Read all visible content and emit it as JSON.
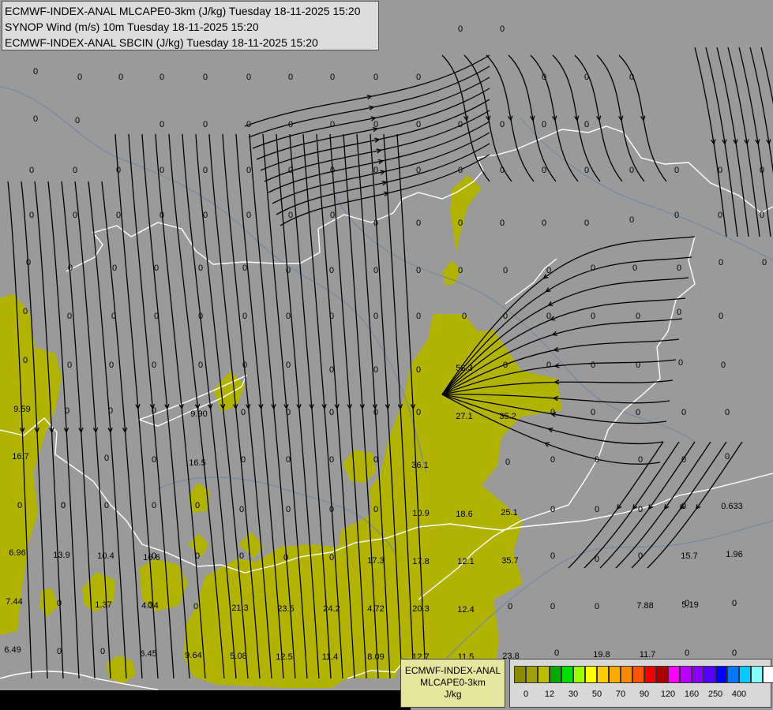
{
  "header": {
    "line1": "ECMWF-INDEX-ANAL MLCAPE0-3km (J/kg) Tuesday 18-11-2025 15:20",
    "line2": "SYNOP Wind (m/s) 10m Tuesday 18-11-2025 15:20",
    "line3": "ECMWF-INDEX-ANAL SBCIN (J/kg) Tuesday 18-11-2025 15:20"
  },
  "legend": {
    "title_line1": "ECMWF-INDEX-ANAL",
    "title_line2": "MLCAPE0-3km",
    "unit": "J/kg",
    "colors": [
      "#8b8b00",
      "#a0a000",
      "#bcbc00",
      "#00aa00",
      "#00dd00",
      "#99ff00",
      "#ffff00",
      "#ffcc00",
      "#ffaa00",
      "#ff8800",
      "#ff5500",
      "#ee0000",
      "#aa0000",
      "#ff00ff",
      "#bb00ff",
      "#8800ff",
      "#5500ff",
      "#0000ff",
      "#0077ff",
      "#00ccff",
      "#88ffff",
      "#ffffff"
    ],
    "ticks": [
      "0",
      "12",
      "30",
      "50",
      "70",
      "90",
      "120",
      "160",
      "250",
      "400"
    ]
  },
  "map_values": {
    "zeros": [
      [
        45,
        90
      ],
      [
        101,
        97
      ],
      [
        153,
        97
      ],
      [
        205,
        97
      ],
      [
        260,
        97
      ],
      [
        315,
        97
      ],
      [
        368,
        97
      ],
      [
        421,
        97
      ],
      [
        476,
        97
      ],
      [
        530,
        97
      ],
      [
        583,
        36
      ],
      [
        636,
        36
      ],
      [
        689,
        97
      ],
      [
        743,
        97
      ],
      [
        800,
        97
      ],
      [
        45,
        150
      ],
      [
        98,
        152
      ],
      [
        205,
        157
      ],
      [
        260,
        157
      ],
      [
        315,
        157
      ],
      [
        368,
        157
      ],
      [
        421,
        157
      ],
      [
        476,
        157
      ],
      [
        530,
        157
      ],
      [
        583,
        157
      ],
      [
        636,
        157
      ],
      [
        689,
        157
      ],
      [
        743,
        157
      ],
      [
        40,
        215
      ],
      [
        95,
        215
      ],
      [
        150,
        215
      ],
      [
        205,
        215
      ],
      [
        260,
        215
      ],
      [
        315,
        215
      ],
      [
        368,
        215
      ],
      [
        421,
        215
      ],
      [
        476,
        215
      ],
      [
        530,
        215
      ],
      [
        583,
        215
      ],
      [
        636,
        215
      ],
      [
        689,
        215
      ],
      [
        743,
        215
      ],
      [
        800,
        215
      ],
      [
        857,
        215
      ],
      [
        912,
        215
      ],
      [
        965,
        215
      ],
      [
        40,
        272
      ],
      [
        95,
        272
      ],
      [
        150,
        272
      ],
      [
        205,
        272
      ],
      [
        260,
        272
      ],
      [
        315,
        272
      ],
      [
        368,
        272
      ],
      [
        421,
        272
      ],
      [
        476,
        282
      ],
      [
        530,
        282
      ],
      [
        583,
        282
      ],
      [
        636,
        282
      ],
      [
        689,
        282
      ],
      [
        743,
        282
      ],
      [
        800,
        278
      ],
      [
        857,
        272
      ],
      [
        912,
        272
      ],
      [
        965,
        272
      ],
      [
        36,
        332
      ],
      [
        89,
        339
      ],
      [
        145,
        339
      ],
      [
        198,
        339
      ],
      [
        254,
        339
      ],
      [
        310,
        339
      ],
      [
        365,
        342
      ],
      [
        420,
        342
      ],
      [
        476,
        342
      ],
      [
        530,
        342
      ],
      [
        583,
        342
      ],
      [
        640,
        342
      ],
      [
        695,
        342
      ],
      [
        751,
        339
      ],
      [
        804,
        339
      ],
      [
        860,
        339
      ],
      [
        913,
        332
      ],
      [
        968,
        332
      ],
      [
        32,
        394
      ],
      [
        88,
        400
      ],
      [
        144,
        400
      ],
      [
        198,
        400
      ],
      [
        254,
        400
      ],
      [
        310,
        400
      ],
      [
        365,
        400
      ],
      [
        420,
        400
      ],
      [
        476,
        400
      ],
      [
        530,
        400
      ],
      [
        588,
        400
      ],
      [
        640,
        400
      ],
      [
        695,
        400
      ],
      [
        751,
        400
      ],
      [
        808,
        400
      ],
      [
        860,
        395
      ],
      [
        913,
        400
      ],
      [
        32,
        456
      ],
      [
        88,
        462
      ],
      [
        141,
        462
      ],
      [
        195,
        462
      ],
      [
        254,
        462
      ],
      [
        310,
        462
      ],
      [
        365,
        462
      ],
      [
        420,
        468
      ],
      [
        476,
        468
      ],
      [
        530,
        468
      ],
      [
        640,
        462
      ],
      [
        695,
        462
      ],
      [
        751,
        462
      ],
      [
        808,
        462
      ],
      [
        862,
        459
      ],
      [
        916,
        462
      ],
      [
        85,
        520
      ],
      [
        140,
        520
      ],
      [
        195,
        520
      ],
      [
        308,
        522
      ],
      [
        365,
        522
      ],
      [
        420,
        522
      ],
      [
        476,
        522
      ],
      [
        530,
        522
      ],
      [
        700,
        522
      ],
      [
        751,
        522
      ],
      [
        808,
        522
      ],
      [
        866,
        522
      ],
      [
        921,
        522
      ],
      [
        25,
        640
      ],
      [
        80,
        640
      ],
      [
        135,
        580
      ],
      [
        195,
        582
      ],
      [
        308,
        582
      ],
      [
        365,
        582
      ],
      [
        420,
        582
      ],
      [
        476,
        582
      ],
      [
        643,
        585
      ],
      [
        700,
        582
      ],
      [
        756,
        582
      ],
      [
        811,
        582
      ],
      [
        866,
        582
      ],
      [
        921,
        578
      ],
      [
        80,
        640
      ],
      [
        135,
        640
      ],
      [
        195,
        640
      ],
      [
        250,
        640
      ],
      [
        306,
        645
      ],
      [
        365,
        645
      ],
      [
        420,
        645
      ],
      [
        476,
        645
      ],
      [
        700,
        645
      ],
      [
        756,
        645
      ],
      [
        811,
        645
      ],
      [
        866,
        641
      ],
      [
        195,
        704
      ],
      [
        250,
        704
      ],
      [
        306,
        704
      ],
      [
        362,
        706
      ],
      [
        420,
        706
      ],
      [
        700,
        704
      ],
      [
        756,
        708
      ],
      [
        811,
        704
      ],
      [
        75,
        764
      ],
      [
        190,
        766
      ],
      [
        248,
        768
      ],
      [
        646,
        768
      ],
      [
        700,
        768
      ],
      [
        756,
        768
      ],
      [
        870,
        764
      ],
      [
        930,
        764
      ],
      [
        75,
        825
      ],
      [
        130,
        825
      ],
      [
        705,
        827
      ],
      [
        870,
        827
      ],
      [
        930,
        827
      ]
    ],
    "labels": [
      {
        "t": "9.59",
        "p": [
          28,
          518
        ]
      },
      {
        "t": "16.7",
        "p": [
          26,
          578
        ]
      },
      {
        "t": "6.96",
        "p": [
          22,
          700
        ]
      },
      {
        "t": "13.9",
        "p": [
          78,
          703
        ]
      },
      {
        "t": "10.4",
        "p": [
          134,
          704
        ]
      },
      {
        "t": "16.6",
        "p": [
          192,
          706
        ]
      },
      {
        "t": "7.44",
        "p": [
          18,
          762
        ]
      },
      {
        "t": "1.37",
        "p": [
          131,
          766
        ]
      },
      {
        "t": "4.34",
        "p": [
          190,
          767
        ]
      },
      {
        "t": "21.3",
        "p": [
          304,
          770
        ]
      },
      {
        "t": "23.5",
        "p": [
          362,
          771
        ]
      },
      {
        "t": "24.2",
        "p": [
          420,
          771
        ]
      },
      {
        "t": "4.72",
        "p": [
          476,
          771
        ]
      },
      {
        "t": "20.3",
        "p": [
          533,
          771
        ]
      },
      {
        "t": "12.4",
        "p": [
          590,
          772
        ]
      },
      {
        "t": "6.49",
        "p": [
          16,
          823
        ]
      },
      {
        "t": "6.45",
        "p": [
          188,
          828
        ]
      },
      {
        "t": "9.64",
        "p": [
          245,
          830
        ]
      },
      {
        "t": "5.08",
        "p": [
          302,
          831
        ]
      },
      {
        "t": "12.5",
        "p": [
          360,
          832
        ]
      },
      {
        "t": "11.4",
        "p": [
          418,
          832
        ]
      },
      {
        "t": "8.09",
        "p": [
          476,
          832
        ]
      },
      {
        "t": "12.7",
        "p": [
          533,
          832
        ]
      },
      {
        "t": "11.5",
        "p": [
          590,
          832
        ]
      },
      {
        "t": "23.8",
        "p": [
          647,
          831
        ]
      },
      {
        "t": "19.8",
        "p": [
          762,
          829
        ]
      },
      {
        "t": "11.7",
        "p": [
          820,
          829
        ]
      },
      {
        "t": "9.90",
        "p": [
          252,
          524
        ]
      },
      {
        "t": "16.5",
        "p": [
          250,
          586
        ]
      },
      {
        "t": "58.3",
        "p": [
          588,
          466
        ]
      },
      {
        "t": "27.1",
        "p": [
          588,
          527
        ]
      },
      {
        "t": "35.2",
        "p": [
          643,
          527
        ]
      },
      {
        "t": "36.1",
        "p": [
          532,
          589
        ]
      },
      {
        "t": "10.9",
        "p": [
          533,
          650
        ]
      },
      {
        "t": "18.6",
        "p": [
          588,
          651
        ]
      },
      {
        "t": "25.1",
        "p": [
          645,
          649
        ]
      },
      {
        "t": "17.3",
        "p": [
          476,
          710
        ]
      },
      {
        "t": "17.8",
        "p": [
          533,
          711
        ]
      },
      {
        "t": "12.1",
        "p": [
          590,
          711
        ]
      },
      {
        "t": "35.7",
        "p": [
          646,
          710
        ]
      },
      {
        "t": "0.633",
        "p": [
          927,
          641
        ]
      },
      {
        "t": "15.7",
        "p": [
          873,
          704
        ]
      },
      {
        "t": "1.96",
        "p": [
          930,
          702
        ]
      },
      {
        "t": "7.88",
        "p": [
          817,
          767
        ]
      },
      {
        "t": "5.19",
        "p": [
          874,
          766
        ]
      }
    ]
  }
}
